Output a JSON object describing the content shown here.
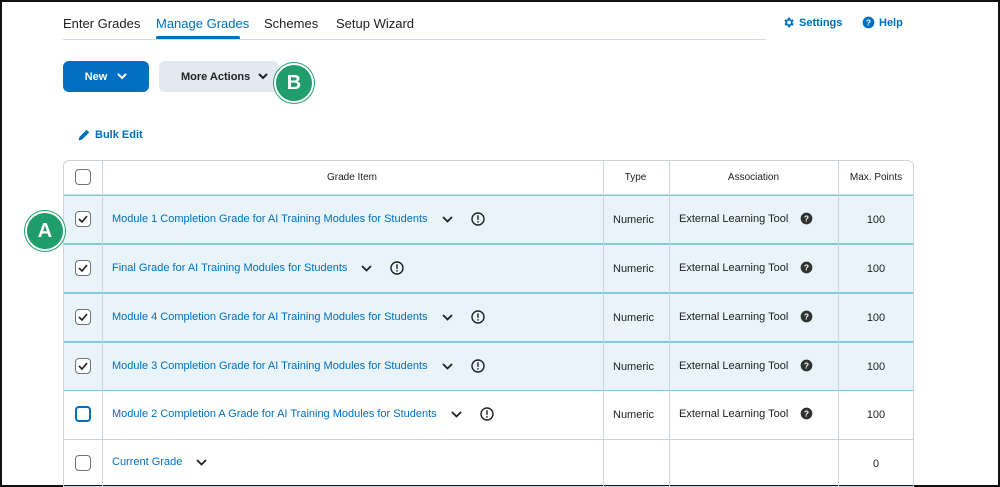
{
  "tabs": [
    {
      "label": "Enter Grades",
      "active": false
    },
    {
      "label": "Manage Grades",
      "active": true
    },
    {
      "label": "Schemes",
      "active": false
    },
    {
      "label": "Setup Wizard",
      "active": false
    }
  ],
  "utility": {
    "settings_label": "Settings",
    "help_label": "Help"
  },
  "toolbar": {
    "new_label": "New",
    "more_actions_label": "More Actions"
  },
  "callouts": {
    "a": "A",
    "b": "B"
  },
  "bulk_edit_label": "Bulk Edit",
  "table": {
    "headers": {
      "grade_item": "Grade Item",
      "type": "Type",
      "association": "Association",
      "max_points": "Max. Points"
    },
    "rows": [
      {
        "name": "Module 1 Completion Grade for AI Training Modules for Students",
        "type": "Numeric",
        "association": "External Learning Tool",
        "max_points": "100",
        "checked": true
      },
      {
        "name": "Final Grade for AI Training Modules for Students",
        "type": "Numeric",
        "association": "External Learning Tool",
        "max_points": "100",
        "checked": true
      },
      {
        "name": "Module 4 Completion Grade for AI Training Modules for Students",
        "type": "Numeric",
        "association": "External Learning Tool",
        "max_points": "100",
        "checked": true
      },
      {
        "name": "Module 3 Completion Grade for AI Training Modules for Students",
        "type": "Numeric",
        "association": "External Learning Tool",
        "max_points": "100",
        "checked": true
      },
      {
        "name": "Module 2 Completion A Grade for AI Training Modules for Students",
        "type": "Numeric",
        "association": "External Learning Tool",
        "max_points": "100",
        "checked": false
      },
      {
        "name": "Current Grade",
        "type": "",
        "association": "",
        "max_points": "0",
        "checked": false
      }
    ]
  },
  "colors": {
    "accent": "#006fbf",
    "callout": "#1f9d6a",
    "selected_row": "#e8f4f9"
  }
}
